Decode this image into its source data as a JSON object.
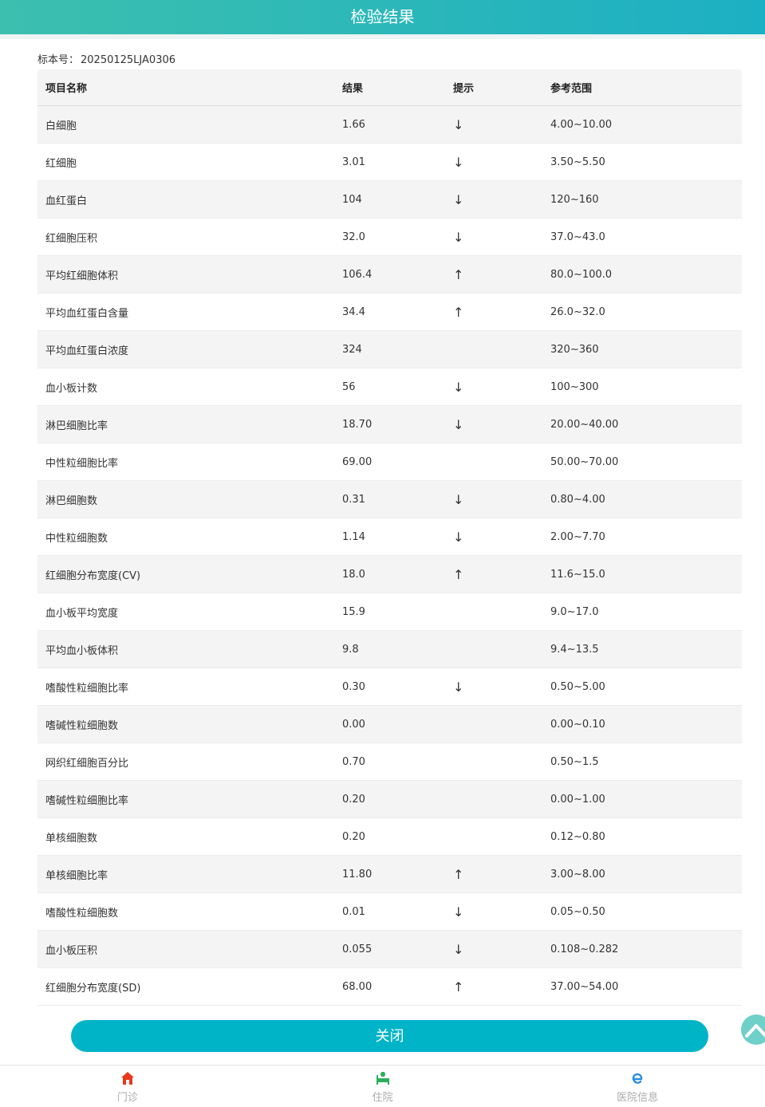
{
  "header": {
    "title": "检验结果"
  },
  "specimen": {
    "label": "标本号：",
    "value": "20250125LJA0306"
  },
  "table": {
    "columns": [
      "项目名称",
      "结果",
      "提示",
      "参考范围"
    ],
    "rows": [
      {
        "name": "白细胞",
        "result": "1.66",
        "flag": "↓",
        "range": "4.00~10.00"
      },
      {
        "name": "红细胞",
        "result": "3.01",
        "flag": "↓",
        "range": "3.50~5.50"
      },
      {
        "name": "血红蛋白",
        "result": "104",
        "flag": "↓",
        "range": "120~160"
      },
      {
        "name": "红细胞压积",
        "result": "32.0",
        "flag": "↓",
        "range": "37.0~43.0"
      },
      {
        "name": "平均红细胞体积",
        "result": "106.4",
        "flag": "↑",
        "range": "80.0~100.0"
      },
      {
        "name": "平均血红蛋白含量",
        "result": "34.4",
        "flag": "↑",
        "range": "26.0~32.0"
      },
      {
        "name": "平均血红蛋白浓度",
        "result": "324",
        "flag": "",
        "range": "320~360"
      },
      {
        "name": "血小板计数",
        "result": "56",
        "flag": "↓",
        "range": "100~300"
      },
      {
        "name": "淋巴细胞比率",
        "result": "18.70",
        "flag": "↓",
        "range": "20.00~40.00"
      },
      {
        "name": "中性粒细胞比率",
        "result": "69.00",
        "flag": "",
        "range": "50.00~70.00"
      },
      {
        "name": "淋巴细胞数",
        "result": "0.31",
        "flag": "↓",
        "range": "0.80~4.00"
      },
      {
        "name": "中性粒细胞数",
        "result": "1.14",
        "flag": "↓",
        "range": "2.00~7.70"
      },
      {
        "name": "红细胞分布宽度(CV)",
        "result": "18.0",
        "flag": "↑",
        "range": "11.6~15.0"
      },
      {
        "name": "血小板平均宽度",
        "result": "15.9",
        "flag": "",
        "range": "9.0~17.0"
      },
      {
        "name": "平均血小板体积",
        "result": "9.8",
        "flag": "",
        "range": "9.4~13.5"
      },
      {
        "name": "嗜酸性粒细胞比率",
        "result": "0.30",
        "flag": "↓",
        "range": "0.50~5.00"
      },
      {
        "name": "嗜碱性粒细胞数",
        "result": "0.00",
        "flag": "",
        "range": "0.00~0.10"
      },
      {
        "name": "网织红细胞百分比",
        "result": "0.70",
        "flag": "",
        "range": "0.50~1.5"
      },
      {
        "name": "嗜碱性粒细胞比率",
        "result": "0.20",
        "flag": "",
        "range": "0.00~1.00"
      },
      {
        "name": "单核细胞数",
        "result": "0.20",
        "flag": "",
        "range": "0.12~0.80"
      },
      {
        "name": "单核细胞比率",
        "result": "11.80",
        "flag": "↑",
        "range": "3.00~8.00"
      },
      {
        "name": "嗜酸性粒细胞数",
        "result": "0.01",
        "flag": "↓",
        "range": "0.05~0.50"
      },
      {
        "name": "血小板压积",
        "result": "0.055",
        "flag": "↓",
        "range": "0.108~0.282"
      },
      {
        "name": "红细胞分布宽度(SD)",
        "result": "68.00",
        "flag": "↑",
        "range": "37.00~54.00"
      }
    ]
  },
  "actions": {
    "close_label": "关闭"
  },
  "footer": {
    "tabs": [
      {
        "label": "门诊",
        "icon": "home-icon",
        "color": "#e8391f"
      },
      {
        "label": "住院",
        "icon": "hospital-bed-icon",
        "color": "#2bb05a"
      },
      {
        "label": "医院信息",
        "icon": "e-info-icon",
        "color": "#2a8de0"
      }
    ]
  },
  "colors": {
    "accent": "#00b4c8",
    "header_start": "#3cbfae",
    "header_end": "#1cb0c4"
  }
}
